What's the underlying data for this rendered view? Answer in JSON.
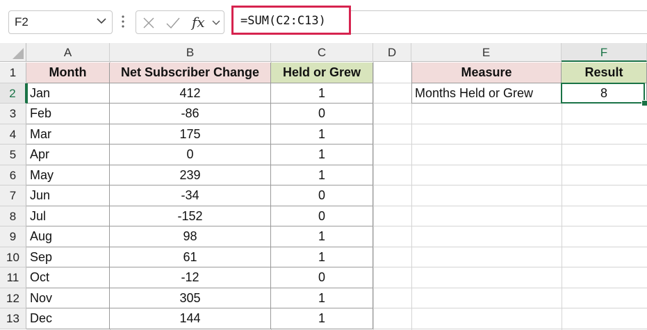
{
  "name_box": {
    "value": "F2"
  },
  "formula_bar": {
    "formula": "=SUM(C2:C13)",
    "fx_label": "fx"
  },
  "columns": [
    "A",
    "B",
    "C",
    "D",
    "E",
    "F"
  ],
  "selected_column": "F",
  "selected_row": 2,
  "rows": [
    "1",
    "2",
    "3",
    "4",
    "5",
    "6",
    "7",
    "8",
    "9",
    "10",
    "11",
    "12",
    "13"
  ],
  "table": {
    "headers": [
      "Month",
      "Net Subscriber Change",
      "Held or Grew"
    ],
    "data": [
      [
        "Jan",
        "412",
        "1"
      ],
      [
        "Feb",
        "-86",
        "0"
      ],
      [
        "Mar",
        "175",
        "1"
      ],
      [
        "Apr",
        "0",
        "1"
      ],
      [
        "May",
        "239",
        "1"
      ],
      [
        "Jun",
        "-34",
        "0"
      ],
      [
        "Jul",
        "-152",
        "0"
      ],
      [
        "Aug",
        "98",
        "1"
      ],
      [
        "Sep",
        "61",
        "1"
      ],
      [
        "Oct",
        "-12",
        "0"
      ],
      [
        "Nov",
        "305",
        "1"
      ],
      [
        "Dec",
        "144",
        "1"
      ]
    ]
  },
  "summary": {
    "headers": [
      "Measure",
      "Result"
    ],
    "row": [
      "Months Held or Grew",
      "8"
    ]
  },
  "colors": {
    "header_pink": "#f2dcdb",
    "header_green": "#d8e4bc",
    "selection_green": "#1a7346",
    "formula_highlight": "#d6234f"
  }
}
